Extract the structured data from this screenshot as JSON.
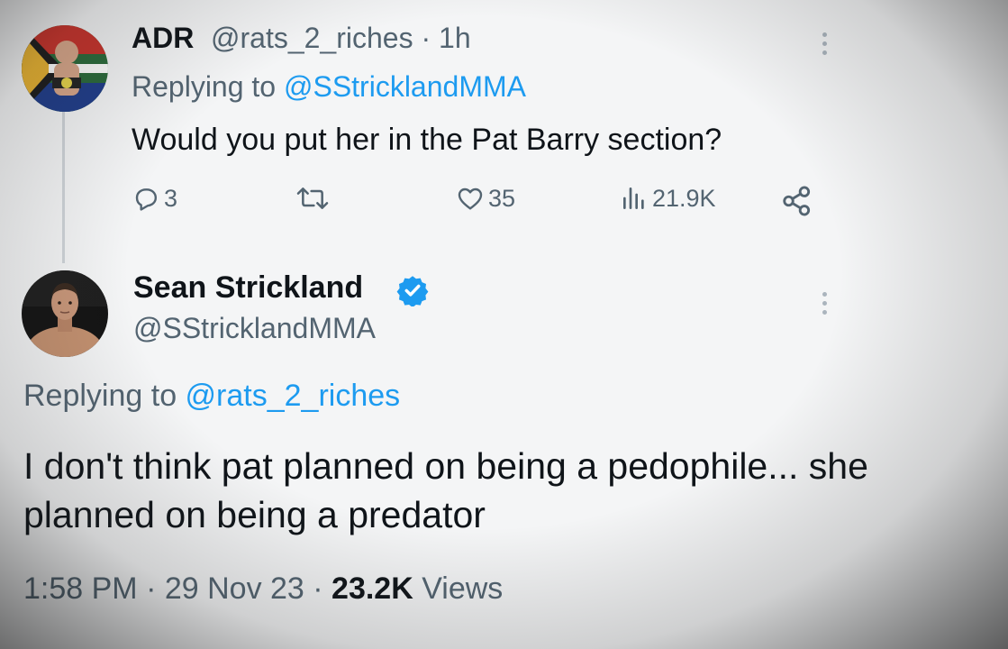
{
  "tweet_reply": {
    "author_name": "ADR",
    "handle_time": "@rats_2_riches · 1h",
    "replying_prefix": "Replying to ",
    "replying_to": "@SStricklandMMA",
    "text": "Would you put her in the Pat Barry section?",
    "replies": "3",
    "likes": "35",
    "views": "21.9K"
  },
  "tweet_main": {
    "author_name": "Sean Strickland",
    "handle": "@SStricklandMMA",
    "replying_prefix": "Replying to ",
    "replying_to": "@rats_2_riches",
    "text": "I don't think pat planned on being a pedophile... she planned on being a predator",
    "time_date": "1:58 PM · 29 Nov 23 · ",
    "views_count": "23.2K",
    "views_label": " Views"
  },
  "icons": {
    "reply": "reply-icon",
    "retweet": "retweet-icon",
    "like": "heart-icon",
    "views": "views-icon",
    "share": "share-icon",
    "verified": "verified-badge-icon",
    "more": "more-options-icon"
  },
  "colors": {
    "accent": "#1d9bf0",
    "secondary_text": "#536471",
    "primary_text": "#0f1419"
  }
}
